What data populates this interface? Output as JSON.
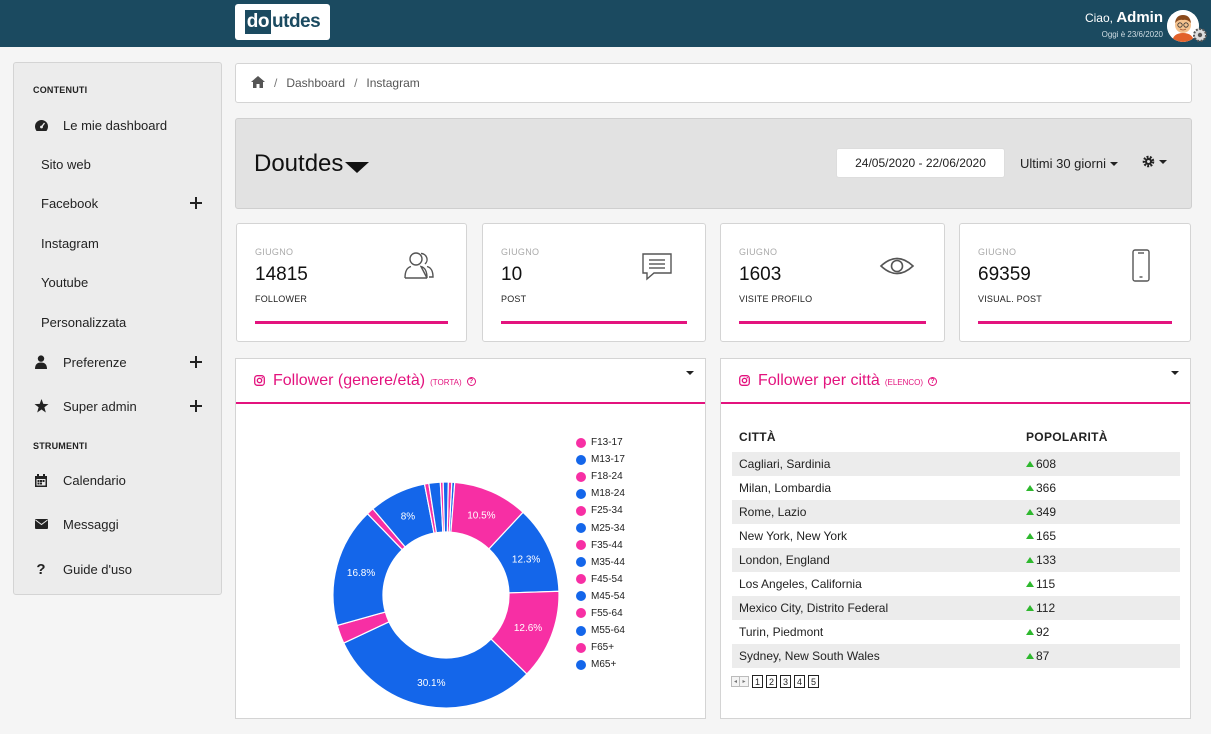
{
  "topbar": {
    "logo_do": "do",
    "logo_rest": "utdes",
    "greeting_prefix": "Ciao,",
    "user_name": "Admin",
    "date_text": "Oggi è 23/6/2020"
  },
  "sidebar": {
    "section_contents": "CONTENUTI",
    "section_tools": "STRUMENTI",
    "items": {
      "dashboards": "Le mie dashboard",
      "website": "Sito web",
      "facebook": "Facebook",
      "instagram": "Instagram",
      "youtube": "Youtube",
      "custom": "Personalizzata",
      "preferences": "Preferenze",
      "superadmin": "Super admin",
      "calendar": "Calendario",
      "messages": "Messaggi",
      "guide": "Guide d'uso"
    }
  },
  "breadcrumb": {
    "dashboard": "Dashboard",
    "current": "Instagram",
    "sep": "/"
  },
  "header": {
    "brand": "Doutdes",
    "date_range": "24/05/2020 - 22/06/2020",
    "period": "Ultimi 30 giorni"
  },
  "stats": [
    {
      "month": "GIUGNO",
      "value": "14815",
      "metric": "FOLLOWER",
      "icon": "users-icon"
    },
    {
      "month": "GIUGNO",
      "value": "10",
      "metric": "POST",
      "icon": "comment-icon"
    },
    {
      "month": "GIUGNO",
      "value": "1603",
      "metric": "VISITE PROFILO",
      "icon": "eye-icon"
    },
    {
      "month": "GIUGNO",
      "value": "69359",
      "metric": "VISUAL. POST",
      "icon": "mobile-icon"
    }
  ],
  "colors": {
    "pink": "#e3137e",
    "female": "#f72fa4",
    "male": "#1466ea",
    "topbar": "#1b4a60"
  },
  "pie_panel": {
    "title": "Follower (genere/età)",
    "subtitle": "(TORTA)",
    "help": "?"
  },
  "chart_data": {
    "type": "pie",
    "title": "Follower (genere/età)",
    "categories": [
      "F13-17",
      "M13-17",
      "F18-24",
      "M18-24",
      "F25-34",
      "M25-34",
      "F35-44",
      "M35-44",
      "F45-54",
      "M45-54",
      "F55-64",
      "M55-64",
      "F65+",
      "M65+"
    ],
    "values": [
      0.5,
      0.4,
      10.5,
      12.3,
      12.6,
      30.1,
      2.6,
      16.8,
      1.0,
      8.0,
      0.6,
      1.6,
      0.4,
      0.7
    ],
    "labels_shown": [
      "",
      "",
      "10.5%",
      "12.3%",
      "12.6%",
      "30.1%",
      "",
      "16.8%",
      "",
      "8%",
      "",
      "",
      "",
      ""
    ],
    "legend_position": "right"
  },
  "city_panel": {
    "title": "Follower per città",
    "subtitle": "(ELENCO)",
    "help": "?",
    "col_city": "CITTÀ",
    "col_pop": "POPOLARITÀ",
    "rows": [
      {
        "city": "Cagliari, Sardinia",
        "value": "608"
      },
      {
        "city": "Milan, Lombardia",
        "value": "366"
      },
      {
        "city": "Rome, Lazio",
        "value": "349"
      },
      {
        "city": "New York, New York",
        "value": "165"
      },
      {
        "city": "London, England",
        "value": "133"
      },
      {
        "city": "Los Angeles, California",
        "value": "115"
      },
      {
        "city": "Mexico City, Distrito Federal",
        "value": "112"
      },
      {
        "city": "Turin, Piedmont",
        "value": "92"
      },
      {
        "city": "Sydney, New South Wales",
        "value": "87"
      }
    ],
    "pages": [
      "1",
      "2",
      "3",
      "4",
      "5"
    ]
  }
}
